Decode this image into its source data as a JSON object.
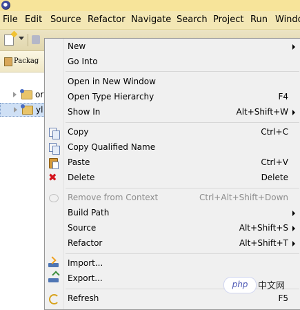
{
  "menubar": {
    "items": [
      {
        "label": "File"
      },
      {
        "label": "Edit"
      },
      {
        "label": "Source"
      },
      {
        "label": "Refactor"
      },
      {
        "label": "Navigate"
      },
      {
        "label": "Search"
      },
      {
        "label": "Project"
      },
      {
        "label": "Run"
      },
      {
        "label": "Windo"
      }
    ]
  },
  "explorer": {
    "title": "Packag",
    "items": [
      {
        "label": "or"
      },
      {
        "label": "yl"
      }
    ]
  },
  "context_menu": {
    "items": [
      {
        "label": "New",
        "accel": "",
        "submenu": true,
        "enabled": true
      },
      {
        "label": "Go Into",
        "accel": "",
        "submenu": false,
        "enabled": true
      },
      {
        "label": "Open in New Window",
        "accel": "",
        "submenu": false,
        "enabled": true
      },
      {
        "label": "Open Type Hierarchy",
        "accel": "F4",
        "submenu": false,
        "enabled": true
      },
      {
        "label": "Show In",
        "accel": "Alt+Shift+W",
        "submenu": true,
        "enabled": true
      },
      {
        "label": "Copy",
        "accel": "Ctrl+C",
        "submenu": false,
        "enabled": true,
        "icon": "copy-icon"
      },
      {
        "label": "Copy Qualified Name",
        "accel": "",
        "submenu": false,
        "enabled": true,
        "icon": "copy-icon"
      },
      {
        "label": "Paste",
        "accel": "Ctrl+V",
        "submenu": false,
        "enabled": true,
        "icon": "paste-icon"
      },
      {
        "label": "Delete",
        "accel": "Delete",
        "submenu": false,
        "enabled": true,
        "icon": "delete-icon"
      },
      {
        "label": "Remove from Context",
        "accel": "Ctrl+Alt+Shift+Down",
        "submenu": false,
        "enabled": false,
        "icon": "remove-context-icon"
      },
      {
        "label": "Build Path",
        "accel": "",
        "submenu": true,
        "enabled": true
      },
      {
        "label": "Source",
        "accel": "Alt+Shift+S",
        "submenu": true,
        "enabled": true
      },
      {
        "label": "Refactor",
        "accel": "Alt+Shift+T",
        "submenu": true,
        "enabled": true
      },
      {
        "label": "Import...",
        "accel": "",
        "submenu": false,
        "enabled": true,
        "icon": "import-icon"
      },
      {
        "label": "Export...",
        "accel": "",
        "submenu": false,
        "enabled": true,
        "icon": "export-icon"
      },
      {
        "label": "Refresh",
        "accel": "F5",
        "submenu": false,
        "enabled": true,
        "icon": "refresh-icon"
      }
    ]
  },
  "watermark": {
    "badge": "php",
    "site": "中文网"
  },
  "colors": {
    "menubar_bg": "#f3e7b4",
    "menu_bg": "#f0f0f0",
    "delete_icon": "#d4141d",
    "selection": "#cfe0f5"
  }
}
